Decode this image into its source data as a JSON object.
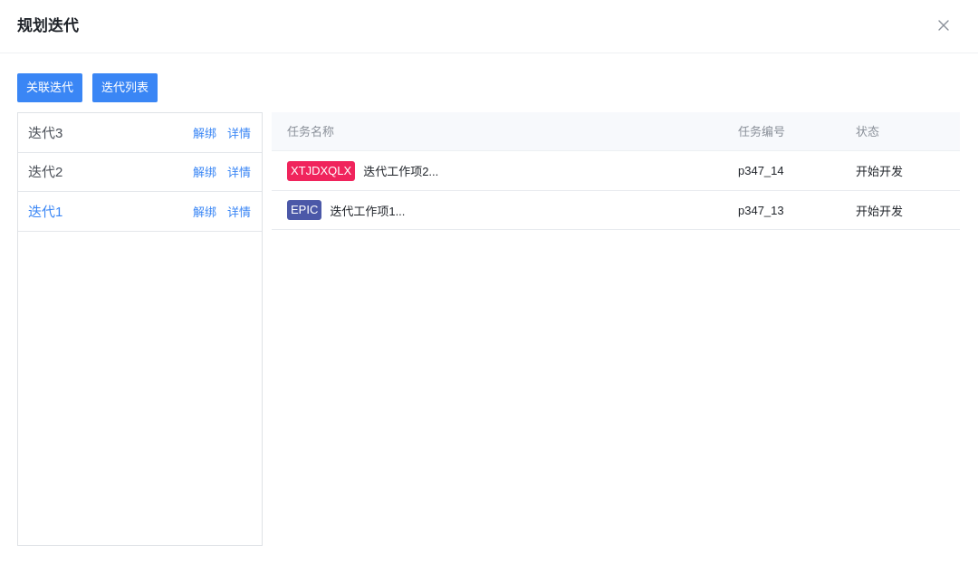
{
  "dialog": {
    "title": "规划迭代",
    "close_icon": "close-icon"
  },
  "toolbar": {
    "link_iteration_label": "关联迭代",
    "iteration_list_label": "迭代列表"
  },
  "iterations": [
    {
      "name": "迭代3",
      "unbind_label": "解绑",
      "detail_label": "详情",
      "active": false
    },
    {
      "name": "迭代2",
      "unbind_label": "解绑",
      "detail_label": "详情",
      "active": false
    },
    {
      "name": "迭代1",
      "unbind_label": "解绑",
      "detail_label": "详情",
      "active": true
    }
  ],
  "table": {
    "columns": [
      "任务名称",
      "任务编号",
      "状态"
    ],
    "rows": [
      {
        "tag": "XTJDXQLX",
        "tag_color": "#f0245c",
        "name": "迭代工作项2...",
        "code": "p347_14",
        "status": "开始开发"
      },
      {
        "tag": "EPIC",
        "tag_color": "#4b58a8",
        "name": "迭代工作项1...",
        "code": "p347_13",
        "status": "开始开发"
      }
    ]
  },
  "colors": {
    "primary": "#3a86f5",
    "tag_red": "#f0245c",
    "tag_indigo": "#4b58a8"
  }
}
